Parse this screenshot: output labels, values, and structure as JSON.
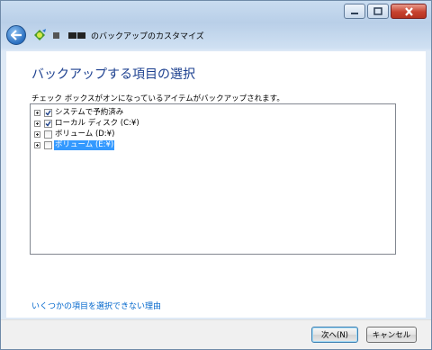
{
  "window": {
    "controls": {
      "minimize_icon": "minimize-icon",
      "maximize_icon": "maximize-icon",
      "close_icon": "close-icon"
    }
  },
  "nav": {
    "back_icon": "back-arrow-icon",
    "app_icon": "backup-app-icon",
    "title": "のバックアップのカスタマイズ"
  },
  "page": {
    "title": "バックアップする項目の選択",
    "instruction": "チェック ボックスがオンになっているアイテムがバックアップされます。"
  },
  "tree": {
    "items": [
      {
        "label": "システムで予約済み",
        "checked": true,
        "selected": false
      },
      {
        "label": "ローカル ディスク (C:¥)",
        "checked": true,
        "selected": false
      },
      {
        "label": "ボリューム (D:¥)",
        "checked": false,
        "selected": false
      },
      {
        "label": "ボリューム (E:¥)",
        "checked": false,
        "selected": true
      }
    ]
  },
  "help_link": "いくつかの項目を選択できない理由",
  "buttons": {
    "next": "次へ(N)",
    "cancel": "キャンセル"
  },
  "colors": {
    "title": "#1b3f8f",
    "link": "#0066cc",
    "selection": "#3399ff"
  }
}
